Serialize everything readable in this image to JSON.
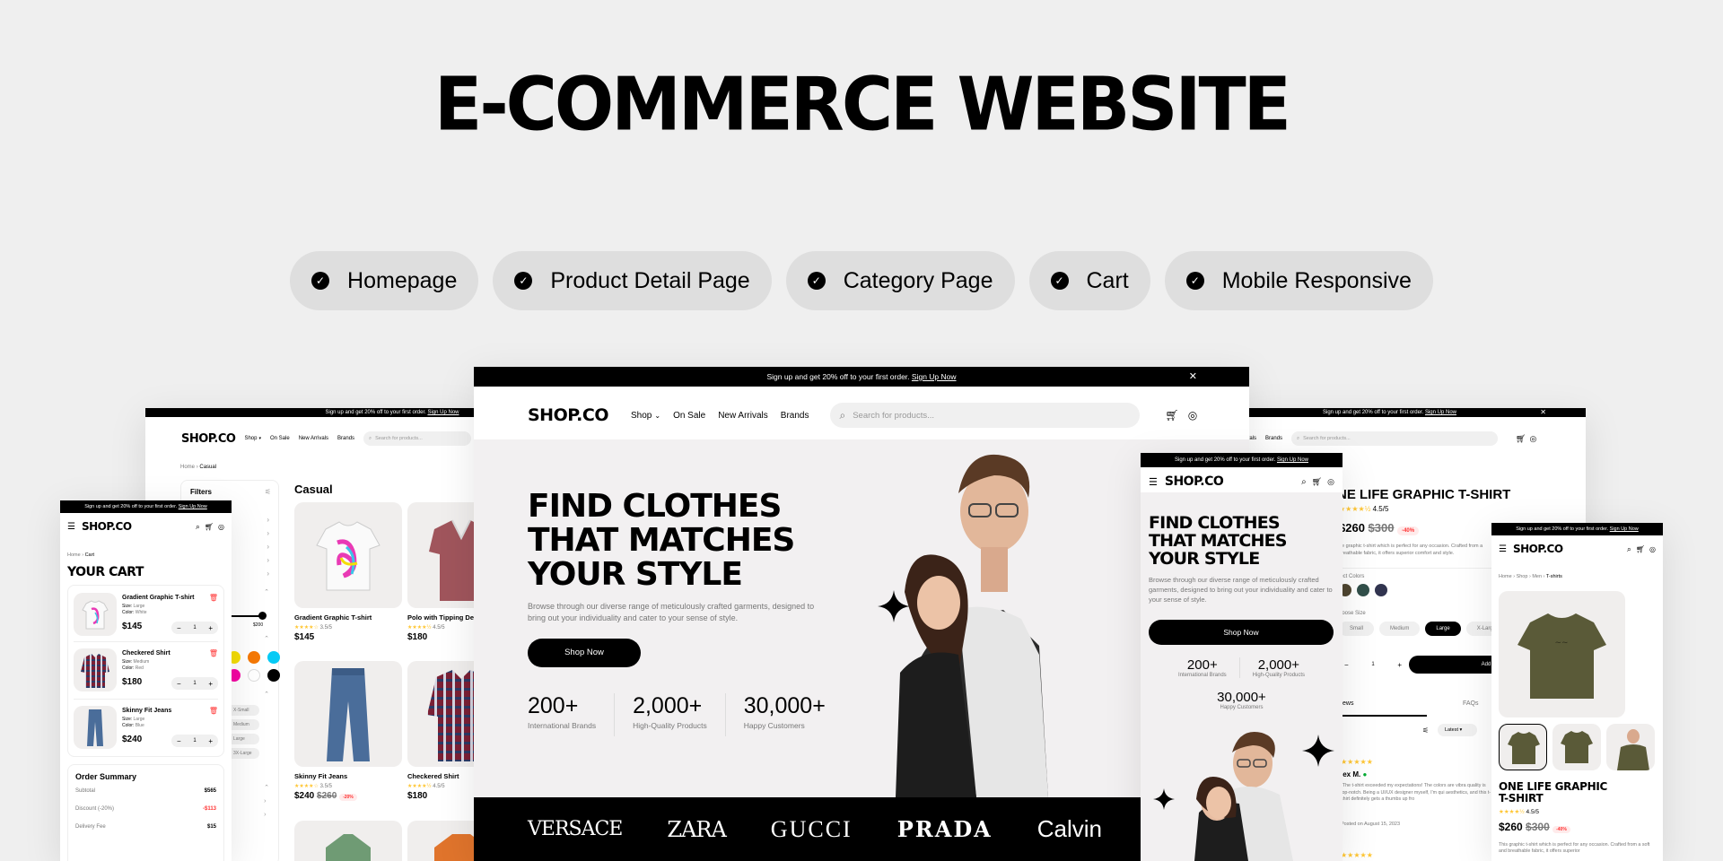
{
  "title": "E-COMMERCE WEBSITE",
  "features": [
    "Homepage",
    "Product Detail Page",
    "Category Page",
    "Cart",
    "Mobile Responsive"
  ],
  "brand": "SHOP.CO",
  "announcement": {
    "text": "Sign up and get 20% off to your first order.",
    "link": "Sign Up Now"
  },
  "nav": {
    "shop": "Shop",
    "on_sale": "On Sale",
    "new_arrivals": "New Arrivals",
    "brands": "Brands"
  },
  "search_placeholder": "Search for products...",
  "hero": {
    "line1": "FIND CLOTHES",
    "line2": "THAT MATCHES",
    "line3": "YOUR STYLE",
    "desc": "Browse through our diverse range of meticulously crafted garments, designed to bring out your individuality and cater to your sense of style.",
    "cta": "Shop Now",
    "stats": [
      {
        "value": "200+",
        "label": "International Brands"
      },
      {
        "value": "2,000+",
        "label": "High-Quality Products"
      },
      {
        "value": "30,000+",
        "label": "Happy Customers"
      }
    ]
  },
  "brands": [
    "VERSACE",
    "ZARA",
    "GUCCI",
    "PRADA",
    "Calvin"
  ],
  "colors": {
    "accent": "#000000",
    "star": "#FFC633",
    "discount": "#FF3333",
    "bg": "#F0F0F0"
  },
  "category": {
    "breadcrumb": [
      "Home",
      "Casual"
    ],
    "filters_label": "Filters",
    "heading": "Casual",
    "price_max": "$200",
    "sizes": [
      "X-Small",
      "Medium",
      "Large",
      "3X-Large"
    ],
    "products": [
      {
        "name": "Gradient Graphic T-shirt",
        "rating": "3.5/5",
        "price": "$145",
        "old": "",
        "off": ""
      },
      {
        "name": "Polo with Tipping De",
        "rating": "4.5/5",
        "price": "$180",
        "old": "",
        "off": ""
      },
      {
        "name": "Skinny Fit Jeans",
        "rating": "3.5/5",
        "price": "$240",
        "old": "$260",
        "off": "-20%"
      },
      {
        "name": "Checkered Shirt",
        "rating": "4.5/5",
        "price": "$180",
        "old": "",
        "off": ""
      }
    ]
  },
  "cart": {
    "breadcrumb": [
      "Home",
      "Cart"
    ],
    "heading": "YOUR CART",
    "items": [
      {
        "name": "Gradient Graphic T-shirt",
        "size": "Large",
        "color": "White",
        "price": "$145",
        "qty": "1"
      },
      {
        "name": "Checkered Shirt",
        "size": "Medium",
        "color": "Red",
        "price": "$180",
        "qty": "1"
      },
      {
        "name": "Skinny Fit Jeans",
        "size": "Large",
        "color": "Blue",
        "price": "$240",
        "qty": "1"
      }
    ],
    "size_label": "Size:",
    "color_label": "Color:",
    "summary": {
      "title": "Order Summary",
      "subtotal_label": "Subtotal",
      "subtotal": "$565",
      "discount_label": "Discount (-20%)",
      "discount": "-$113",
      "delivery_label": "Delivery Fee",
      "delivery": "$15"
    }
  },
  "product": {
    "title": "ONE LIFE GRAPHIC T-SHIRT",
    "title_line1": "ONE LIFE GRAPHIC",
    "title_line2": "T-SHIRT",
    "title_cut": "NE LIFE GRAPHIC T-SHIRT",
    "rating": "4.5/5",
    "price": "$260",
    "old": "$300",
    "off": "-40%",
    "desc": "This graphic t-shirt which is perfect for any occasion. Crafted from a soft and breathable fabric, it offers superior comfort and style.",
    "desc_cut1": "ue graphic t-shirt which is perfect for any occasion. Crafted from a",
    "desc_cut2": "breathable fabric, it offers superior comfort and style.",
    "select_colors": "Select Colors",
    "select_colors_cut": "lect Colors",
    "choose_size": "Choose Size",
    "choose_size_cut": "hoose Size",
    "sizes": [
      "Small",
      "Medium",
      "Large",
      "X-Large"
    ],
    "qty": "1",
    "add_to_cart": "Add to Cart",
    "add_to_cart_cut": "Add to Car",
    "reviews_tab": "Reviews",
    "reviews_tab_cut": "ews",
    "faqs_tab": "FAQs",
    "sort": "Latest",
    "review": {
      "author": "Alex M.",
      "author_cut": "lex M.",
      "text": "\"The t-shirt exceeded my expectations! The colors are vibrant and the print quality is top-notch. Being a UI/UX designer myself, I'm quite picky about aesthetics, and this t-shirt definitely gets a thumbs up from me.\"",
      "text_cut": "\"The t-shirt exceeded my expectations! The colors are vibra quality is top-notch. Being a UI/UX designer myself, I'm qui aesthetics, and this t-shirt definitely gets a thumbs up fro",
      "date": "Posted on August 15, 2023"
    },
    "breadcrumb": [
      "Home",
      "Shop",
      "Men",
      "T-shirts"
    ],
    "mobile_desc": "This graphic t-shirt which is perfect for any occasion. Crafted from a soft and breathable fabric, it offers superior"
  },
  "nav_cut": {
    "new_arrivals": "Arrivals"
  }
}
